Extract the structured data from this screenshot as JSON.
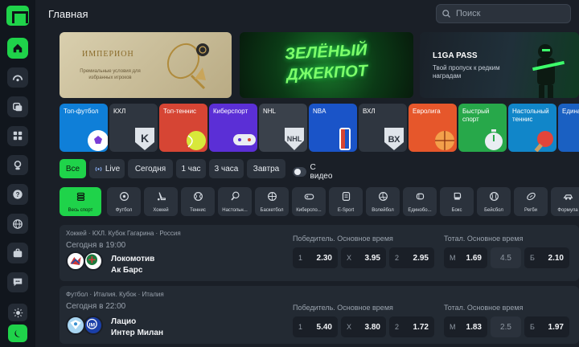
{
  "header": {
    "title": "Главная",
    "search_placeholder": "Поиск"
  },
  "colors": {
    "accent": "#1fd34a",
    "background": "#1a1f27",
    "sidebar": "#11161d",
    "card": "#232a33"
  },
  "sidebar": {
    "items": [
      {
        "icon": "home-icon",
        "active": true
      },
      {
        "icon": "live-gauge-icon"
      },
      {
        "icon": "coupons-icon"
      },
      {
        "icon": "grid-icon"
      },
      {
        "icon": "trophy-icon"
      },
      {
        "icon": "help-icon"
      },
      {
        "icon": "globe-icon"
      },
      {
        "icon": "briefcase-icon"
      },
      {
        "icon": "chat-icon"
      }
    ]
  },
  "banners": [
    {
      "title": "ИМПЕРИОН",
      "subtitle": "Премиальные условия для избранных игроков"
    },
    {
      "title": "ЗЕЛЁНЫЙ ДЖЕКПОТ"
    },
    {
      "title": "L1GA PASS",
      "subtitle": "Твой пропуск к редким наградам"
    }
  ],
  "tiles": [
    {
      "label": "Топ-футбол",
      "color": "#0f7fd8"
    },
    {
      "label": "КХЛ",
      "color": "#2f3640"
    },
    {
      "label": "Топ-теннис",
      "color": "#d64534"
    },
    {
      "label": "Киберспорт",
      "color": "#5b2fd6"
    },
    {
      "label": "NHL",
      "color": "#3a414b"
    },
    {
      "label": "NBA",
      "color": "#1a54c8"
    },
    {
      "label": "ВХЛ",
      "color": "#2f3640"
    },
    {
      "label": "Евролига",
      "color": "#e6572b"
    },
    {
      "label": "Быстрый спорт",
      "color": "#27a84a"
    },
    {
      "label": "Настольный теннис",
      "color": "#1186c9"
    },
    {
      "label": "Единая ВТБ",
      "color": "#1a60c2"
    }
  ],
  "filters": {
    "pills": [
      "Все",
      "Live",
      "Сегодня",
      "1 час",
      "3 часа",
      "Завтра"
    ],
    "video_label": "С видео"
  },
  "sports": [
    "Весь спорт",
    "Футбол",
    "Хоккей",
    "Теннис",
    "Настольн...",
    "Баскетбол",
    "Киберспо...",
    "E-Sport",
    "Волейбол",
    "Единобо...",
    "Бокс",
    "Бейсбол",
    "Регби",
    "Формула"
  ],
  "events": [
    {
      "league": "Хоккей · КХЛ. Кубок Гагарина · Россия",
      "time": "Сегодня в 19:00",
      "team1": "Локомотив",
      "team2": "Ак Барс",
      "market1_title": "Победитель. Основное время",
      "market2_title": "Тотал. Основное время",
      "odds": [
        {
          "k": "1",
          "v": "2.30"
        },
        {
          "k": "X",
          "v": "3.95"
        },
        {
          "k": "2",
          "v": "2.95"
        }
      ],
      "totals": [
        {
          "k": "М",
          "v": "1.69"
        },
        {
          "k": "",
          "v": "4.5"
        },
        {
          "k": "Б",
          "v": "2.10"
        }
      ]
    },
    {
      "league": "Футбол · Италия. Кубок · Италия",
      "time": "Сегодня в 22:00",
      "team1": "Лацио",
      "team2": "Интер Милан",
      "market1_title": "Победитель. Основное время",
      "market2_title": "Тотал. Основное время",
      "odds": [
        {
          "k": "1",
          "v": "5.40"
        },
        {
          "k": "X",
          "v": "3.80"
        },
        {
          "k": "2",
          "v": "1.72"
        }
      ],
      "totals": [
        {
          "k": "М",
          "v": "1.83"
        },
        {
          "k": "",
          "v": "2.5"
        },
        {
          "k": "Б",
          "v": "1.97"
        }
      ]
    }
  ]
}
